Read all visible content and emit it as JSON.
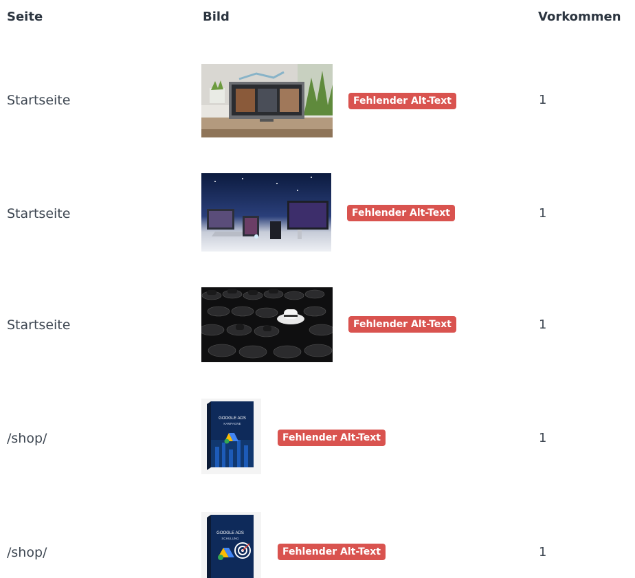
{
  "table": {
    "headers": {
      "page": "Seite",
      "image": "Bild",
      "occurrences": "Vorkommen"
    },
    "rows": [
      {
        "page": "Startseite",
        "image_icon": "tv-gallery-image",
        "badge": "Fehlender Alt-Text",
        "count": "1"
      },
      {
        "page": "Startseite",
        "image_icon": "devices-night-image",
        "badge": "Fehlender Alt-Text",
        "count": "1"
      },
      {
        "page": "Startseite",
        "image_icon": "black-white-hats-image",
        "badge": "Fehlender Alt-Text",
        "count": "1"
      },
      {
        "page": "/shop/",
        "image_icon": "google-ads-kampagne-box-image",
        "badge": "Fehlender Alt-Text",
        "count": "1"
      },
      {
        "page": "/shop/",
        "image_icon": "google-ads-schulung-box-image",
        "badge": "Fehlender Alt-Text",
        "count": "1"
      }
    ]
  },
  "images": {
    "box1_title": "GOOGLE ADS",
    "box1_sub": "KAMPAGNE",
    "box2_title": "GOOGLE ADS",
    "box2_sub": "SCHULUNG"
  },
  "colors": {
    "badge_bg": "#d9534f",
    "header_text": "#2c3540",
    "body_text": "#3d4651"
  }
}
